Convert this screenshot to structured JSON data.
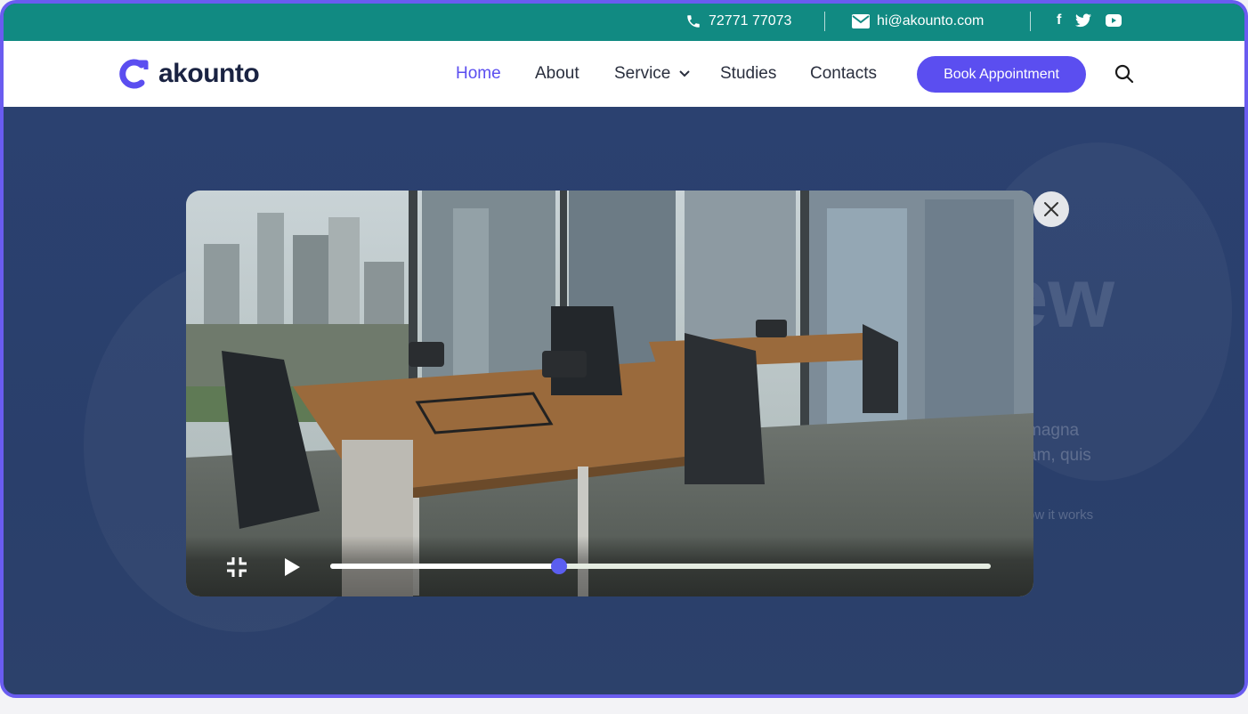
{
  "topbar": {
    "phone": "72771 77073",
    "email": "hi@akounto.com",
    "social": [
      "f",
      "twitter",
      "youtube"
    ]
  },
  "nav": {
    "logo_text": "akounto",
    "items": [
      {
        "label": "Home",
        "active": true
      },
      {
        "label": "About",
        "active": false
      },
      {
        "label": "Service",
        "active": false,
        "dropdown": true
      },
      {
        "label": "Studies",
        "active": false
      },
      {
        "label": "Contacts",
        "active": false
      }
    ],
    "cta_label": "Book Appointment",
    "accent_color": "#5b4ef0"
  },
  "hero": {
    "faded_title": "ew",
    "faded_text_line1": "magna",
    "faded_text_line2": "am, quis",
    "faded_link": "ow it works"
  },
  "video": {
    "progress": 0.347,
    "state": "paused",
    "controls": [
      "exit-fullscreen-icon",
      "play-icon"
    ]
  },
  "colors": {
    "topbar": "#118a82",
    "hero_bg": "#2a3f6a",
    "progress_thumb": "#5b5ef0"
  }
}
